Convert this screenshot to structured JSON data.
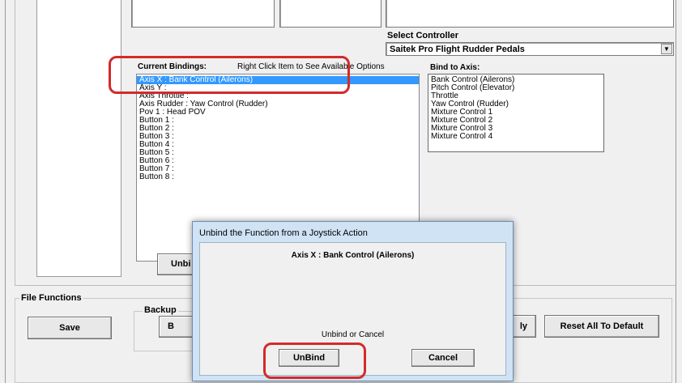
{
  "select_controller": {
    "label": "Select Controller",
    "selected": "Saitek Pro Flight Rudder Pedals"
  },
  "current_bindings": {
    "label": "Current Bindings:",
    "hint": "Right Click Item to See Available Options",
    "items": [
      "Axis X : Bank Control (Ailerons)",
      "Axis Y :",
      "Axis Throttle :",
      "Axis Rudder : Yaw Control (Rudder)",
      "Pov 1 : Head POV",
      "Button 1 :",
      "Button 2 :",
      "Button 3 :",
      "Button 4 :",
      "Button 5 :",
      "Button 6 :",
      "Button 7 :",
      "Button 8 :"
    ]
  },
  "bind_to_axis": {
    "label": "Bind to Axis:",
    "items": [
      "Bank Control (Ailerons)",
      "Pitch Control  (Elevator)",
      "Throttle",
      "Yaw Control (Rudder)",
      "Mixture Control 1",
      "Mixture Control 2",
      "Mixture Control 3",
      "Mixture Control 4"
    ]
  },
  "unbind_button_partial": "Unbi",
  "file_functions": {
    "label": "File Functions",
    "save_label": "Save",
    "backup_label": "Backup",
    "backup_button_partial": "B",
    "apply_partial": "ly",
    "reset_label": "Reset All To Default"
  },
  "dialog": {
    "title": "Unbind the Function from a Joystick Action",
    "message": "Axis X : Bank Control (Ailerons)",
    "prompt": "Unbind or Cancel",
    "unbind_label": "UnBind",
    "cancel_label": "Cancel"
  },
  "colors": {
    "selection": "#3399ff",
    "annotation_red": "#d42a2a",
    "window_bg": "#f0f0f0"
  }
}
